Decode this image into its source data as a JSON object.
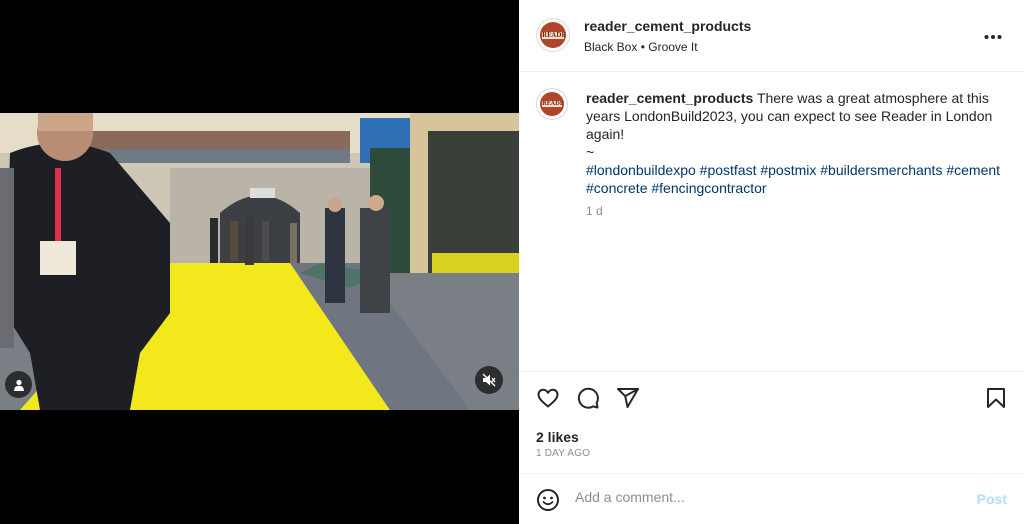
{
  "post": {
    "username": "reader_cement_products",
    "avatar_text": "READER",
    "audio": {
      "artist": "Black Box",
      "separator": "•",
      "track": "Groove It"
    },
    "more_icon": "more-horizontal-icon",
    "caption": {
      "username": "reader_cement_products",
      "text": "There was a great atmosphere at this years LondonBuild2023, you can expect to see Reader in London again!",
      "tilde": "~",
      "hashtags": "#londonbuildexpo #postfast #postmix #buildersmerchants #cement #concrete #fencingcontractor",
      "time": "1 d"
    },
    "likes": "2 likes",
    "date": "1 DAY AGO"
  },
  "actions": {
    "like_icon": "heart-icon",
    "comment_icon": "comment-icon",
    "share_icon": "share-icon",
    "save_icon": "bookmark-icon"
  },
  "media": {
    "tag_icon": "user-tag-icon",
    "mute_icon": "speaker-muted-icon"
  },
  "comment": {
    "placeholder": "Add a comment...",
    "post_label": "Post",
    "emoji_icon": "emoji-icon"
  },
  "colors": {
    "hashtag": "#00376b",
    "post_disabled": "#b2dffc",
    "muted_text": "#8e8e8e",
    "carpet_yellow": "#f2e81c"
  }
}
